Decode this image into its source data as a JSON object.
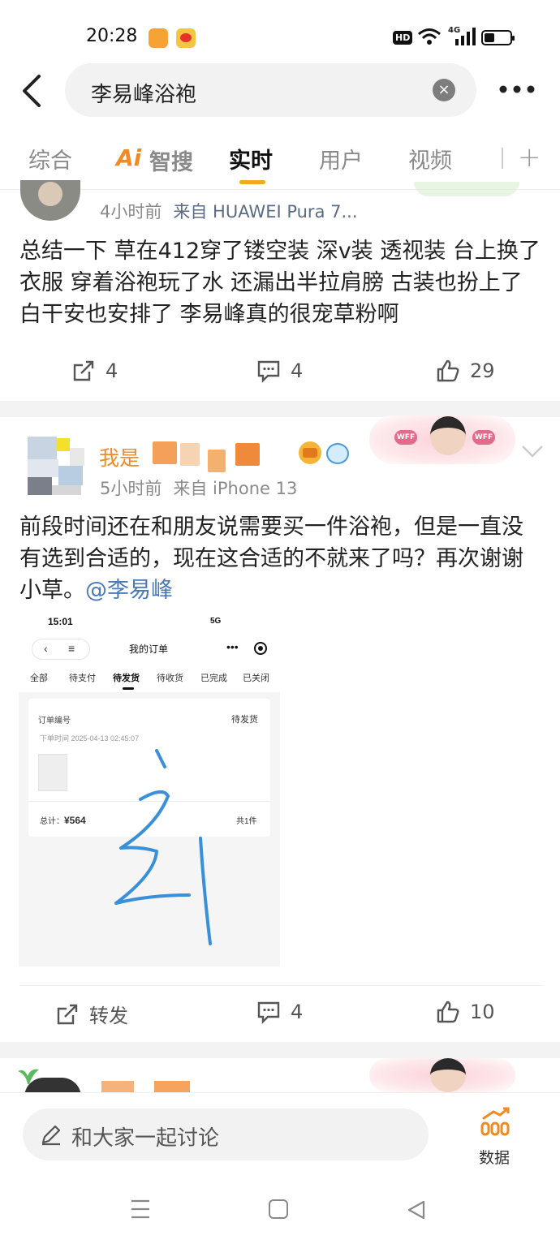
{
  "status_bar": {
    "time": "20:28",
    "hd": "HD",
    "signal": "4G"
  },
  "search": {
    "query": "李易峰浴袍",
    "clear": "×"
  },
  "tabs": [
    {
      "label": "综合"
    },
    {
      "label": "智搜",
      "prefix": "Ai"
    },
    {
      "label": "实时"
    },
    {
      "label": "用户"
    },
    {
      "label": "视频"
    }
  ],
  "active_tab": "实时",
  "posts": [
    {
      "meta_time": "4小时前",
      "meta_source": "来自 HUAWEI Pura 7...",
      "text": "总结一下 草在412穿了镂空装 深v装 透视装 台上换了衣服 穿着浴袍玩了水 还漏出半拉肩膀 古装也扮上了 白干安也安排了 李易峰真的很宠草粉啊",
      "repost": "4",
      "comments": "4",
      "likes": "29"
    },
    {
      "name_visible": "我是",
      "meta_time": "5小时前",
      "meta_source": "来自 iPhone 13",
      "text": "前段时间还在和朋友说需要买一件浴袍，但是一直没有选到合适的，现在这合适的不就来了吗？再次谢谢小草。",
      "mention": "@李易峰",
      "fan_tag": "WFF",
      "repost_label": "转发",
      "comments": "4",
      "likes": "10",
      "screenshot": {
        "time": "15:01",
        "signal": "5G",
        "title": "我的订单",
        "tabs": [
          "全部",
          "待支付",
          "待发货",
          "待收货",
          "已完成",
          "已关闭"
        ],
        "order_label": "订单编号",
        "status": "待发货",
        "date": "下单时间 2025-04-13 02:45:07",
        "total_label": "总计：",
        "total_value": "¥564",
        "count": "共1件",
        "handwritten": "zl"
      }
    }
  ],
  "bottom": {
    "placeholder": "和大家一起讨论",
    "data_label": "数据"
  },
  "colors": {
    "accent": "#f5a623",
    "mention": "#4a78b8",
    "username": "#f08a24"
  }
}
